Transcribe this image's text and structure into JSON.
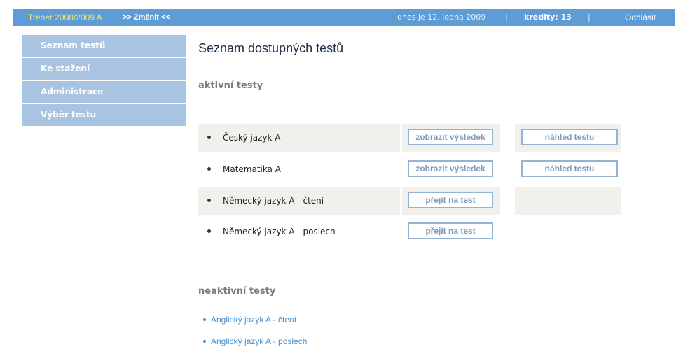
{
  "header": {
    "trainer": "Trenér 2008/2009 A",
    "change_link": ">> Změnit <<",
    "date": "dnes je 12. ledna 2009",
    "separator": "|",
    "credits": "kredity: 13",
    "logout": "Odhlásit"
  },
  "sidebar": {
    "items": [
      {
        "label": "Seznam testů"
      },
      {
        "label": "Ke stažení"
      },
      {
        "label": "Administrace"
      },
      {
        "label": "Výběr testu"
      }
    ]
  },
  "main": {
    "title": "Seznam dostupných testů",
    "active_title": "aktivní testy",
    "active_tests": [
      {
        "name": "Český jazyk A",
        "result_button": "zobrazit výsledek",
        "preview_button": "náhled testu"
      },
      {
        "name": "Matematika A",
        "result_button": "zobrazit výsledek",
        "preview_button": "náhled testu"
      },
      {
        "name": "Německý jazyk A - čtení",
        "go_button": "přejít na test"
      },
      {
        "name": "Německý jazyk A - poslech",
        "go_button": "přejít na test"
      }
    ],
    "inactive_title": "neaktivní testy",
    "inactive_tests": [
      {
        "name": "Anglický jazyk A - čtení"
      },
      {
        "name": "Anglický jazyk A - poslech"
      }
    ]
  },
  "colors": {
    "topbar": "#5d9cd4",
    "sidebar_item": "#a8c4e0",
    "row_shaded": "#f2f0ec",
    "button_border": "#93b3d3",
    "link": "#4a8fd0"
  }
}
